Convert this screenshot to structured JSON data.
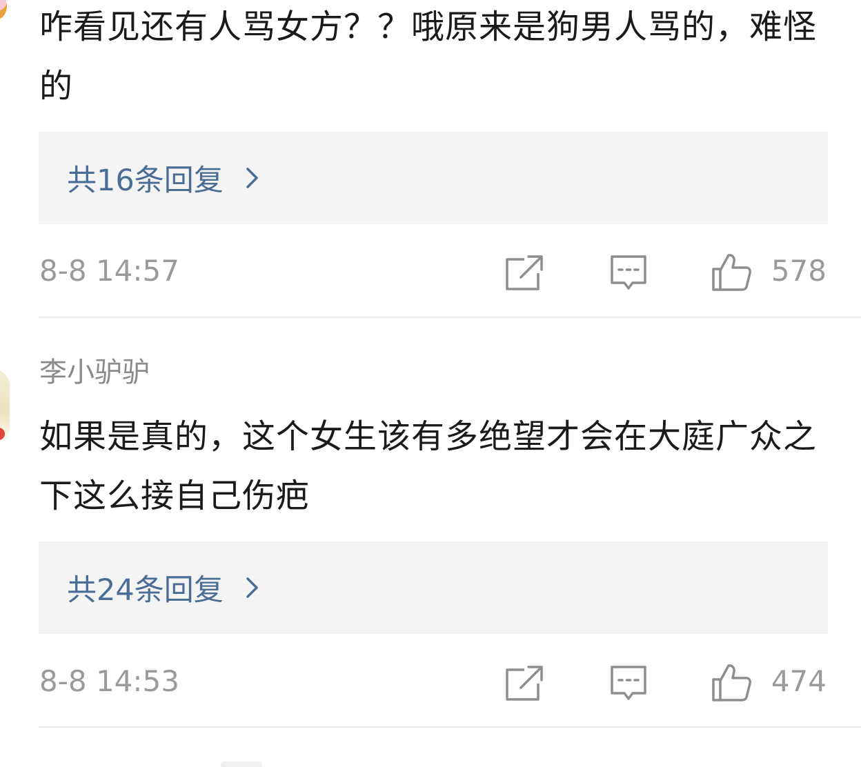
{
  "comments": [
    {
      "username": "",
      "text": "咋看见还有人骂女方？？哦原来是狗男人骂的，难怪的",
      "replies_label": "共16条回复",
      "timestamp": "8-8 14:57",
      "likes": "578",
      "avatar_icon": "user-avatar"
    },
    {
      "username": "李小驴驴",
      "text": "如果是真的，这个女生该有多绝望才会在大庭广众之下这么接自己伤疤",
      "replies_label": "共24条回复",
      "timestamp": "8-8 14:53",
      "likes": "474",
      "avatar_icon": "user-avatar"
    }
  ],
  "icons": {
    "share": "share-icon",
    "comment": "comment-icon",
    "like": "thumbs-up-icon",
    "chevron": "chevron-right-icon"
  },
  "colors": {
    "reply_link": "#4a6d96",
    "meta_text": "#9a9a9a",
    "reply_box_bg": "#f4f4f4",
    "icon_stroke": "#8e8e8e"
  }
}
